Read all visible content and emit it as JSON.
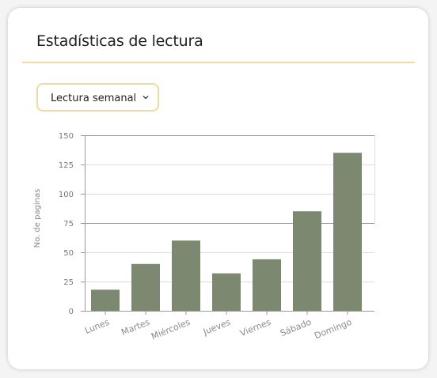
{
  "card": {
    "title": "Estadísticas de lectura",
    "accent_color": "#f1d9a3"
  },
  "dropdown": {
    "selected": "Lectura semanal",
    "icon": "chevron-down-icon"
  },
  "chart_data": {
    "type": "bar",
    "categories": [
      "Lunes",
      "Martes",
      "Miércoles",
      "Jueves",
      "Viernes",
      "Sábado",
      "Domingo"
    ],
    "values": [
      18,
      40,
      60,
      32,
      44,
      85,
      135
    ],
    "ylabel": "No. de paginas",
    "ylim": [
      0,
      150
    ],
    "yticks": [
      0,
      25,
      50,
      75,
      100,
      125,
      150
    ],
    "bar_color": "#7d8870",
    "grid": true,
    "ytick_labels": [
      "0",
      "25",
      "50",
      "75",
      "100",
      "125",
      "150"
    ]
  }
}
